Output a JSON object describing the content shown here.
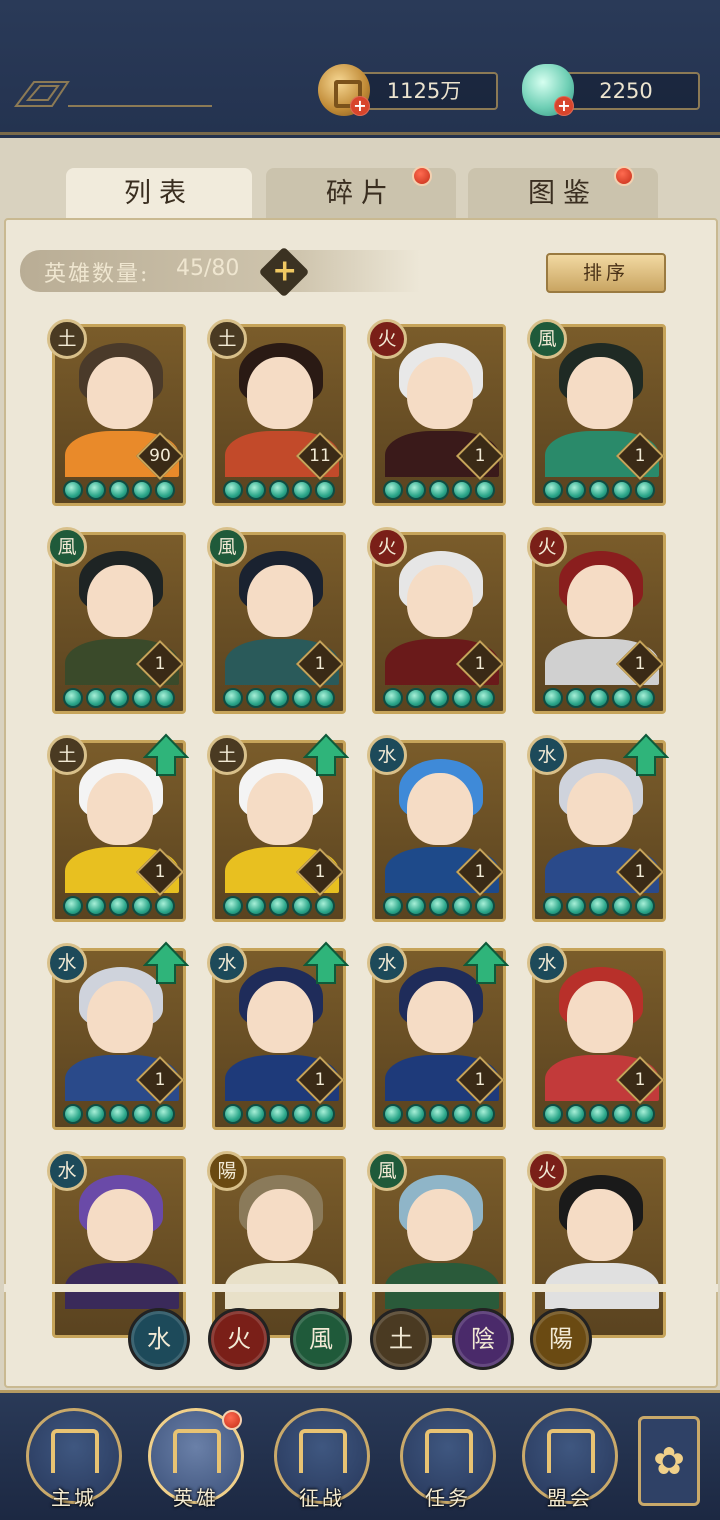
{
  "resources": {
    "coins": "1125万",
    "jade": "2250"
  },
  "tabs": [
    {
      "label": "列表",
      "active": true,
      "red_dot": false
    },
    {
      "label": "碎片",
      "active": false,
      "red_dot": true
    },
    {
      "label": "图鉴",
      "active": false,
      "red_dot": true
    }
  ],
  "hero_count": {
    "label": "英雄数量:",
    "value": "45/80"
  },
  "sort_label": "排序",
  "element_glyphs": {
    "earth": "土",
    "fire": "火",
    "wind": "風",
    "water": "水",
    "yin": "陰",
    "yang": "陽"
  },
  "element_colors": {
    "earth": "#4a3a22",
    "fire": "#7a1f18",
    "wind": "#1f5a3a",
    "water": "#1d4a5a",
    "yin": "#4a2a6a",
    "yang": "#6a4a12"
  },
  "heroes": [
    {
      "element": "土",
      "level": "90",
      "upgrade": false
    },
    {
      "element": "土",
      "level": "11",
      "upgrade": false
    },
    {
      "element": "火",
      "level": "1",
      "upgrade": false
    },
    {
      "element": "風",
      "level": "1",
      "upgrade": false
    },
    {
      "element": "風",
      "level": "1",
      "upgrade": false
    },
    {
      "element": "風",
      "level": "1",
      "upgrade": false
    },
    {
      "element": "火",
      "level": "1",
      "upgrade": false
    },
    {
      "element": "火",
      "level": "1",
      "upgrade": false
    },
    {
      "element": "土",
      "level": "1",
      "upgrade": true
    },
    {
      "element": "土",
      "level": "1",
      "upgrade": true
    },
    {
      "element": "水",
      "level": "1",
      "upgrade": false
    },
    {
      "element": "水",
      "level": "1",
      "upgrade": true
    },
    {
      "element": "水",
      "level": "1",
      "upgrade": true
    },
    {
      "element": "水",
      "level": "1",
      "upgrade": true
    },
    {
      "element": "水",
      "level": "1",
      "upgrade": true
    },
    {
      "element": "水",
      "level": "1",
      "upgrade": false
    },
    {
      "element": "水",
      "level": "",
      "upgrade": false
    },
    {
      "element": "陽",
      "level": "",
      "upgrade": false
    },
    {
      "element": "風",
      "level": "",
      "upgrade": false
    },
    {
      "element": "火",
      "level": "",
      "upgrade": false
    }
  ],
  "filters": [
    "水",
    "火",
    "風",
    "土",
    "陰",
    "陽"
  ],
  "nav": [
    {
      "label": "主城",
      "active": false,
      "red_dot": false
    },
    {
      "label": "英雄",
      "active": true,
      "red_dot": true
    },
    {
      "label": "征战",
      "active": false,
      "red_dot": false
    },
    {
      "label": "任务",
      "active": false,
      "red_dot": false
    },
    {
      "label": "盟会",
      "active": false,
      "red_dot": false
    }
  ]
}
